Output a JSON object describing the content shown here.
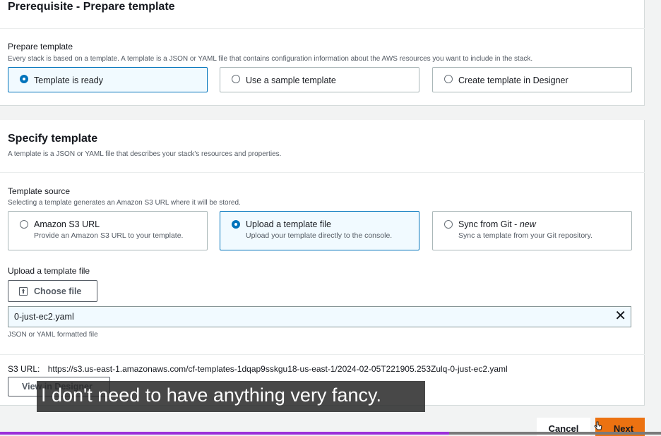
{
  "prepare": {
    "section_title": "Prerequisite - Prepare template",
    "field_label": "Prepare template",
    "field_desc": "Every stack is based on a template. A template is a JSON or YAML file that contains configuration information about the AWS resources you want to include in the stack.",
    "options": [
      {
        "label": "Template is ready",
        "selected": true
      },
      {
        "label": "Use a sample template",
        "selected": false
      },
      {
        "label": "Create template in Designer",
        "selected": false
      }
    ]
  },
  "specify": {
    "section_title": "Specify template",
    "section_desc": "A template is a JSON or YAML file that describes your stack's resources and properties.",
    "source_label": "Template source",
    "source_desc": "Selecting a template generates an Amazon S3 URL where it will be stored.",
    "sources": [
      {
        "title": "Amazon S3 URL",
        "subtitle": "Provide an Amazon S3 URL to your template.",
        "selected": false
      },
      {
        "title": "Upload a template file",
        "subtitle": "Upload your template directly to the console.",
        "selected": true
      },
      {
        "title": "Sync from Git - ",
        "title_tag": "new",
        "subtitle": "Sync a template from your Git repository.",
        "selected": false
      }
    ],
    "upload_label": "Upload a template file",
    "choose_file_label": "Choose file",
    "file_name": "0-just-ec2.yaml",
    "file_hint": "JSON or YAML formatted file",
    "s3_key": "S3 URL:",
    "s3_url": "https://s3.us-east-1.amazonaws.com/cf-templates-1dqap9sskgu18-us-east-1/2024-02-05T221905.253Zulq-0-just-ec2.yaml",
    "view_designer_label": "View in Designer"
  },
  "footer": {
    "cancel_label": "Cancel",
    "next_label": "Next"
  },
  "caption": "I don't need to have anything very fancy.",
  "video_progress": 0.68,
  "colors": {
    "accent": "#0073bb",
    "primary_button": "#ec7211",
    "progress": "#9b30d9"
  }
}
